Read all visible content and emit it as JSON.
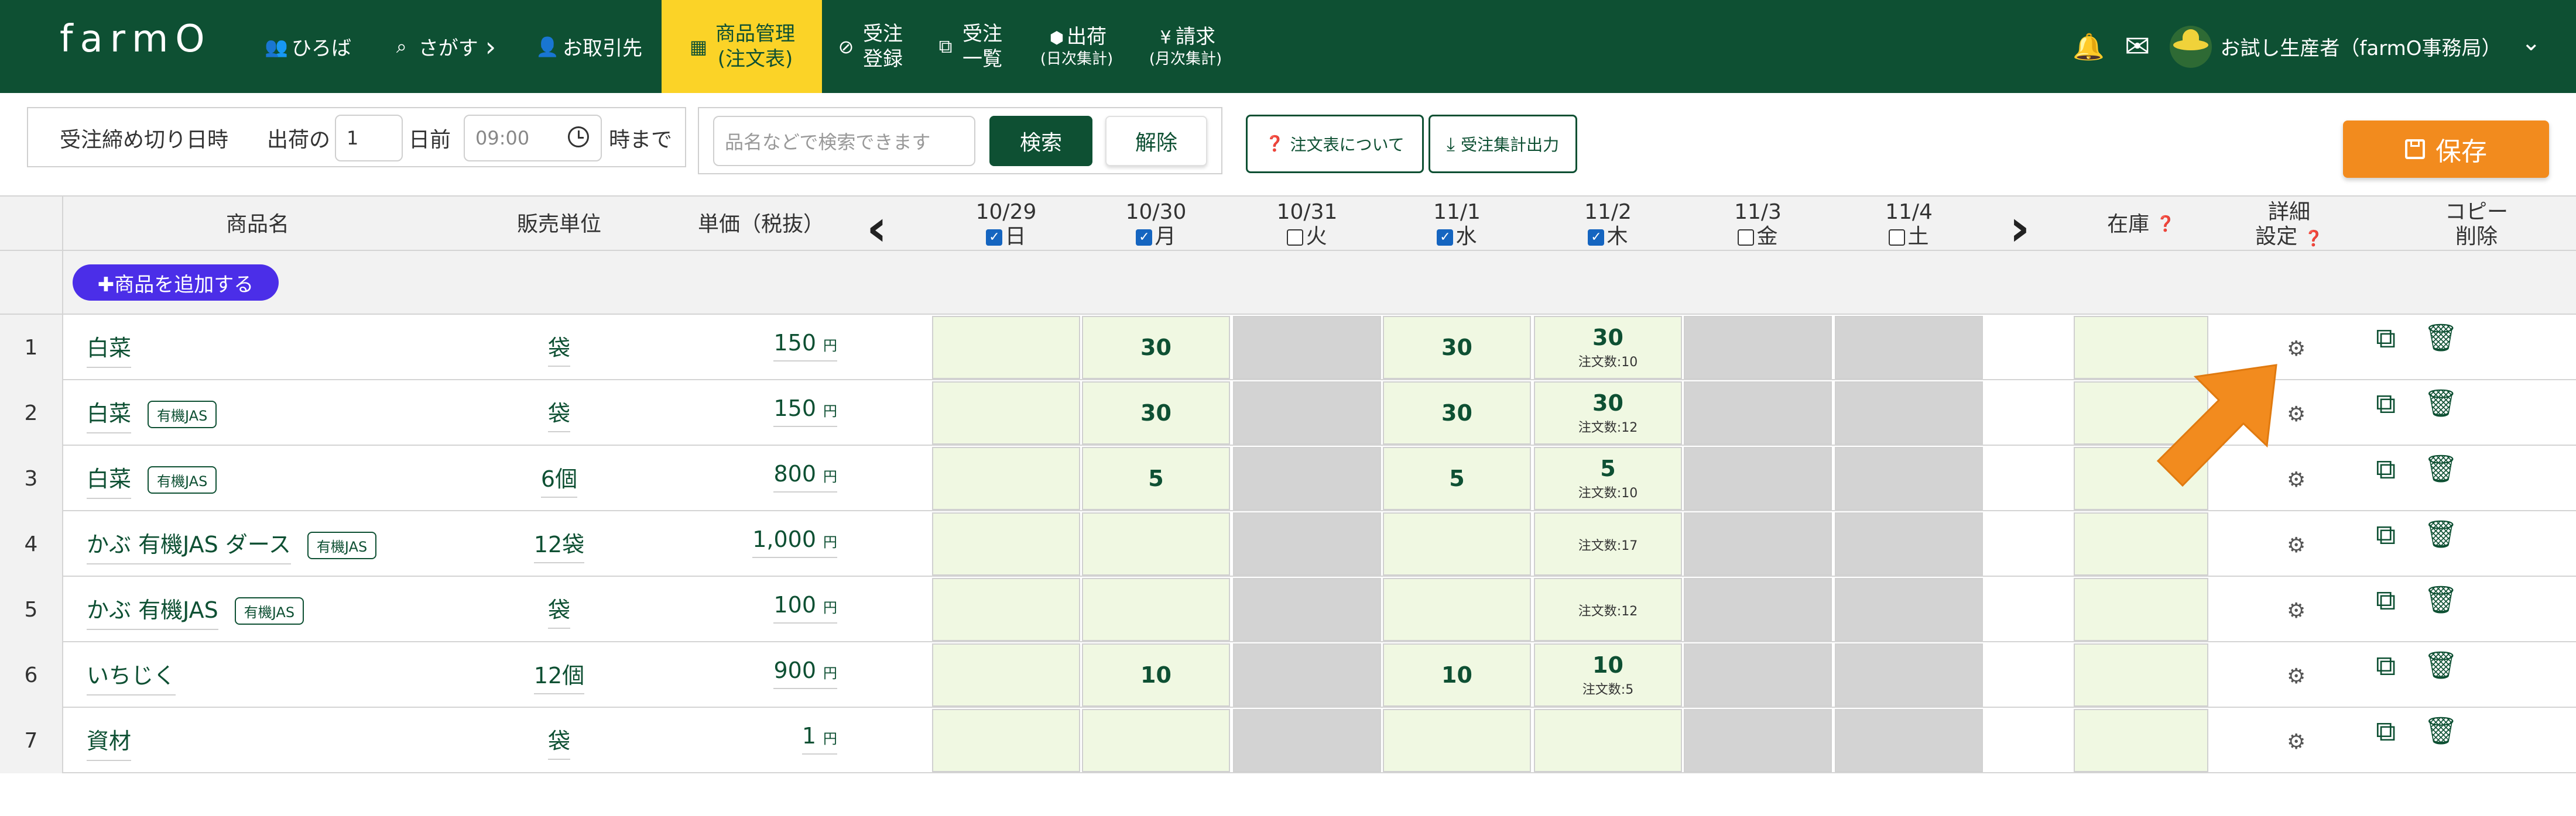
{
  "header": {
    "logo": "farmO",
    "nav": [
      {
        "id": "hiroba",
        "icon": "group-icon",
        "glyph": "👥",
        "label": "ひろば"
      },
      {
        "id": "sagasu",
        "icon": "search-icon",
        "glyph": "🔍",
        "label": "さがす",
        "chevron": "›"
      },
      {
        "id": "torihiki",
        "icon": "user-icon",
        "glyph": "👤",
        "label": "お取引先"
      }
    ],
    "active_nav": {
      "icon": "table-icon",
      "glyph": "▦",
      "line1": "商品管理",
      "line2": "(注文表)"
    },
    "nav2": [
      {
        "id": "juchu_toroku",
        "icon": "check-circle-icon",
        "glyph": "✔",
        "line1": "受注",
        "line2": "登録"
      },
      {
        "id": "juchu_ichiran",
        "icon": "copy-icon",
        "glyph": "⧉",
        "line1": "受注",
        "line2": "一覧"
      },
      {
        "id": "shukka",
        "icon": "box-icon",
        "glyph": "⬢",
        "line1": "出荷",
        "line2": "(日次集計)"
      },
      {
        "id": "seikyu",
        "icon": "yen-icon",
        "glyph": "¥",
        "line1": "請求",
        "line2": "(月次集計)"
      }
    ],
    "user_name": "お試し生産者（farmO事務局）",
    "bell_glyph": "🔔",
    "mail_glyph": "✉",
    "chevron": "⌄"
  },
  "toolbar": {
    "deadline_label": "受注締め切り日時",
    "shipping_prefix": "出荷の",
    "days_value": "1",
    "days_suffix": "日前",
    "time_value": "09:00",
    "time_suffix": "時まで",
    "search_placeholder": "品名などで検索できます",
    "search_button": "検索",
    "clear_button": "解除",
    "about_button": "注文表について",
    "export_button": "受注集計出力",
    "save_button": "保存"
  },
  "table": {
    "headers": {
      "name": "商品名",
      "unit": "販売単位",
      "price": "単価（税抜）",
      "stock": "在庫",
      "detail_line1": "詳細",
      "detail_line2": "設定",
      "copy_line1": "コピー",
      "copy_line2": "削除"
    },
    "days": [
      {
        "date": "10/29",
        "dow": "日",
        "checked": true
      },
      {
        "date": "10/30",
        "dow": "月",
        "checked": true
      },
      {
        "date": "10/31",
        "dow": "火",
        "checked": false
      },
      {
        "date": "11/1",
        "dow": "水",
        "checked": true
      },
      {
        "date": "11/2",
        "dow": "木",
        "checked": true
      },
      {
        "date": "11/3",
        "dow": "金",
        "checked": false
      },
      {
        "date": "11/4",
        "dow": "土",
        "checked": false
      }
    ],
    "add_button": "✚商品を追加する",
    "yen_label": "円",
    "rows": [
      {
        "no": "1",
        "name": "白菜",
        "badge": "",
        "unit": "袋",
        "price": "150",
        "qty": [
          "",
          "30",
          "",
          "30",
          "30",
          "",
          ""
        ],
        "orders": [
          "",
          "",
          "",
          "",
          "注文数:10",
          "",
          ""
        ]
      },
      {
        "no": "2",
        "name": "白菜",
        "badge": "有機JAS",
        "unit": "袋",
        "price": "150",
        "qty": [
          "",
          "30",
          "",
          "30",
          "30",
          "",
          ""
        ],
        "orders": [
          "",
          "",
          "",
          "",
          "注文数:12",
          "",
          ""
        ]
      },
      {
        "no": "3",
        "name": "白菜",
        "badge": "有機JAS",
        "unit": "6個",
        "price": "800",
        "qty": [
          "",
          "5",
          "",
          "5",
          "5",
          "",
          ""
        ],
        "orders": [
          "",
          "",
          "",
          "",
          "注文数:10",
          "",
          ""
        ]
      },
      {
        "no": "4",
        "name": "かぶ 有機JAS ダース",
        "badge": "有機JAS",
        "unit": "12袋",
        "price": "1,000",
        "qty": [
          "",
          "",
          "",
          "",
          "",
          "",
          ""
        ],
        "orders": [
          "",
          "",
          "",
          "",
          "注文数:17",
          "",
          ""
        ]
      },
      {
        "no": "5",
        "name": "かぶ 有機JAS",
        "badge": "有機JAS",
        "unit": "袋",
        "price": "100",
        "qty": [
          "",
          "",
          "",
          "",
          "",
          "",
          ""
        ],
        "orders": [
          "",
          "",
          "",
          "",
          "注文数:12",
          "",
          ""
        ]
      },
      {
        "no": "6",
        "name": "いちじく",
        "badge": "",
        "unit": "12個",
        "price": "900",
        "qty": [
          "",
          "10",
          "",
          "10",
          "10",
          "",
          ""
        ],
        "orders": [
          "",
          "",
          "",
          "",
          "注文数:5",
          "",
          ""
        ]
      },
      {
        "no": "7",
        "name": "資材",
        "badge": "",
        "unit": "袋",
        "price": "1",
        "qty": [
          "",
          "",
          "",
          "",
          "",
          "",
          ""
        ],
        "orders": [
          "",
          "",
          "",
          "",
          "",
          "",
          ""
        ]
      }
    ]
  },
  "colors": {
    "brand": "#0e5033",
    "active": "#fbd327",
    "save": "#f28b1e",
    "add": "#4b2ee8",
    "cell": "#f0f8e2",
    "closed": "#d3d3d3"
  }
}
